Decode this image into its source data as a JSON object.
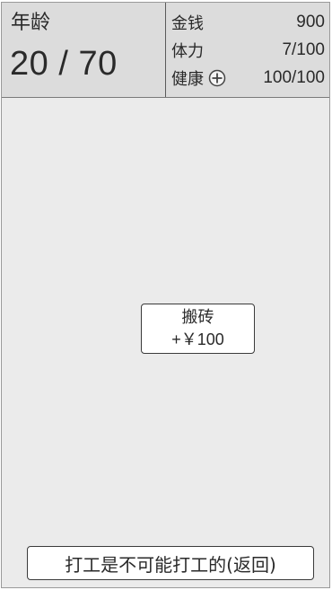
{
  "header": {
    "age_label": "年龄",
    "age_value": "20 / 70"
  },
  "stats": [
    {
      "label": "金钱",
      "value": "900"
    },
    {
      "label": "体力",
      "value": "7/100"
    },
    {
      "label": "健康",
      "value": "100/100",
      "icon": "plus-circle-icon"
    }
  ],
  "job": {
    "name": "搬砖",
    "reward": "+￥100"
  },
  "footer": {
    "back_label": "打工是不可能打工的(返回)"
  }
}
